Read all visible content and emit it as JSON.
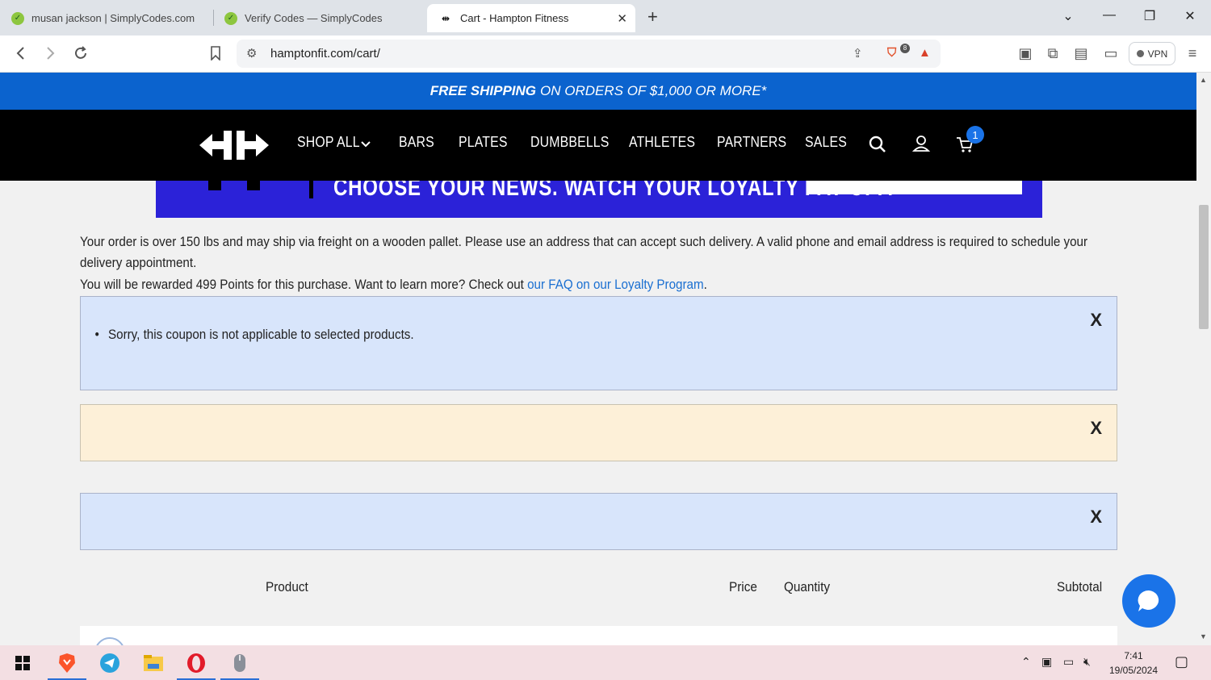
{
  "browser": {
    "tabs": [
      {
        "title": "musan jackson | SimplyCodes.com"
      },
      {
        "title": "Verify Codes — SimplyCodes"
      },
      {
        "title": "Cart - Hampton Fitness"
      }
    ],
    "url": "hamptonfit.com/cart/",
    "vpn_label": "VPN",
    "shield_count": "8"
  },
  "promo": {
    "bold": "FREE SHIPPING",
    "rest": "ON ORDERS OF $1,000 OR MORE*"
  },
  "nav": {
    "items": [
      "SHOP ALL",
      "BARS",
      "PLATES",
      "DUMBBELLS",
      "ATHLETES",
      "PARTNERS",
      "SALES"
    ],
    "cart_count": "1"
  },
  "banner": {
    "text": "CHOOSE YOUR NEWS. WATCH YOUR LOYALTY PAY OFF."
  },
  "notices": {
    "freight": "Your order is over 150 lbs and may ship via freight on a wooden pallet. Please use an address that can accept such delivery. A valid phone and email address is required to schedule your",
    "freight_2": "delivery appointment.",
    "points_prefix": "You will be rewarded 499 Points for this purchase. Want to learn more? Check out ",
    "points_link": "our FAQ on our Loyalty Program",
    "points_suffix": "."
  },
  "alerts": {
    "coupon_error": "Sorry, this coupon is not applicable to selected products.",
    "close_glyph": "X"
  },
  "table": {
    "headers": {
      "product": "Product",
      "price": "Price",
      "quantity": "Quantity",
      "subtotal": "Subtotal"
    }
  },
  "taskbar": {
    "time": "7:41",
    "date": "19/05/2024"
  },
  "colors": {
    "promo_bg": "#0b63ce",
    "nav_bg": "#000000",
    "alert_blue": "#d8e5fb",
    "alert_yellow": "#fdf0d8",
    "link": "#1a6fd1",
    "chat": "#1a73e8"
  }
}
